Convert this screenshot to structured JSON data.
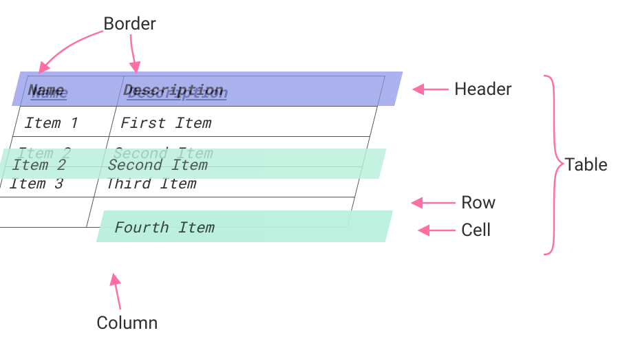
{
  "labels": {
    "border": "Border",
    "header": "Header",
    "table": "Table",
    "row": "Row",
    "cell": "Cell",
    "column": "Column"
  },
  "table": {
    "columns": {
      "name": "Name",
      "description": "Description"
    },
    "rows": [
      {
        "name": "Item 1",
        "description": "First Item"
      },
      {
        "name": "Item 2",
        "description": "Second Item"
      },
      {
        "name": "Item 3",
        "description": "Third Item"
      },
      {
        "name": "",
        "description": ""
      }
    ]
  },
  "highlights": {
    "header_cells": {
      "name": "Name",
      "description": "Description"
    },
    "row_cells": {
      "name": "Item 2",
      "description": "Second Item"
    },
    "cell_value": "Fourth Item"
  },
  "colors": {
    "arrow": "#ff6fa5",
    "header_fill": "#8a94e6",
    "row_fill": "#b9efdc"
  }
}
